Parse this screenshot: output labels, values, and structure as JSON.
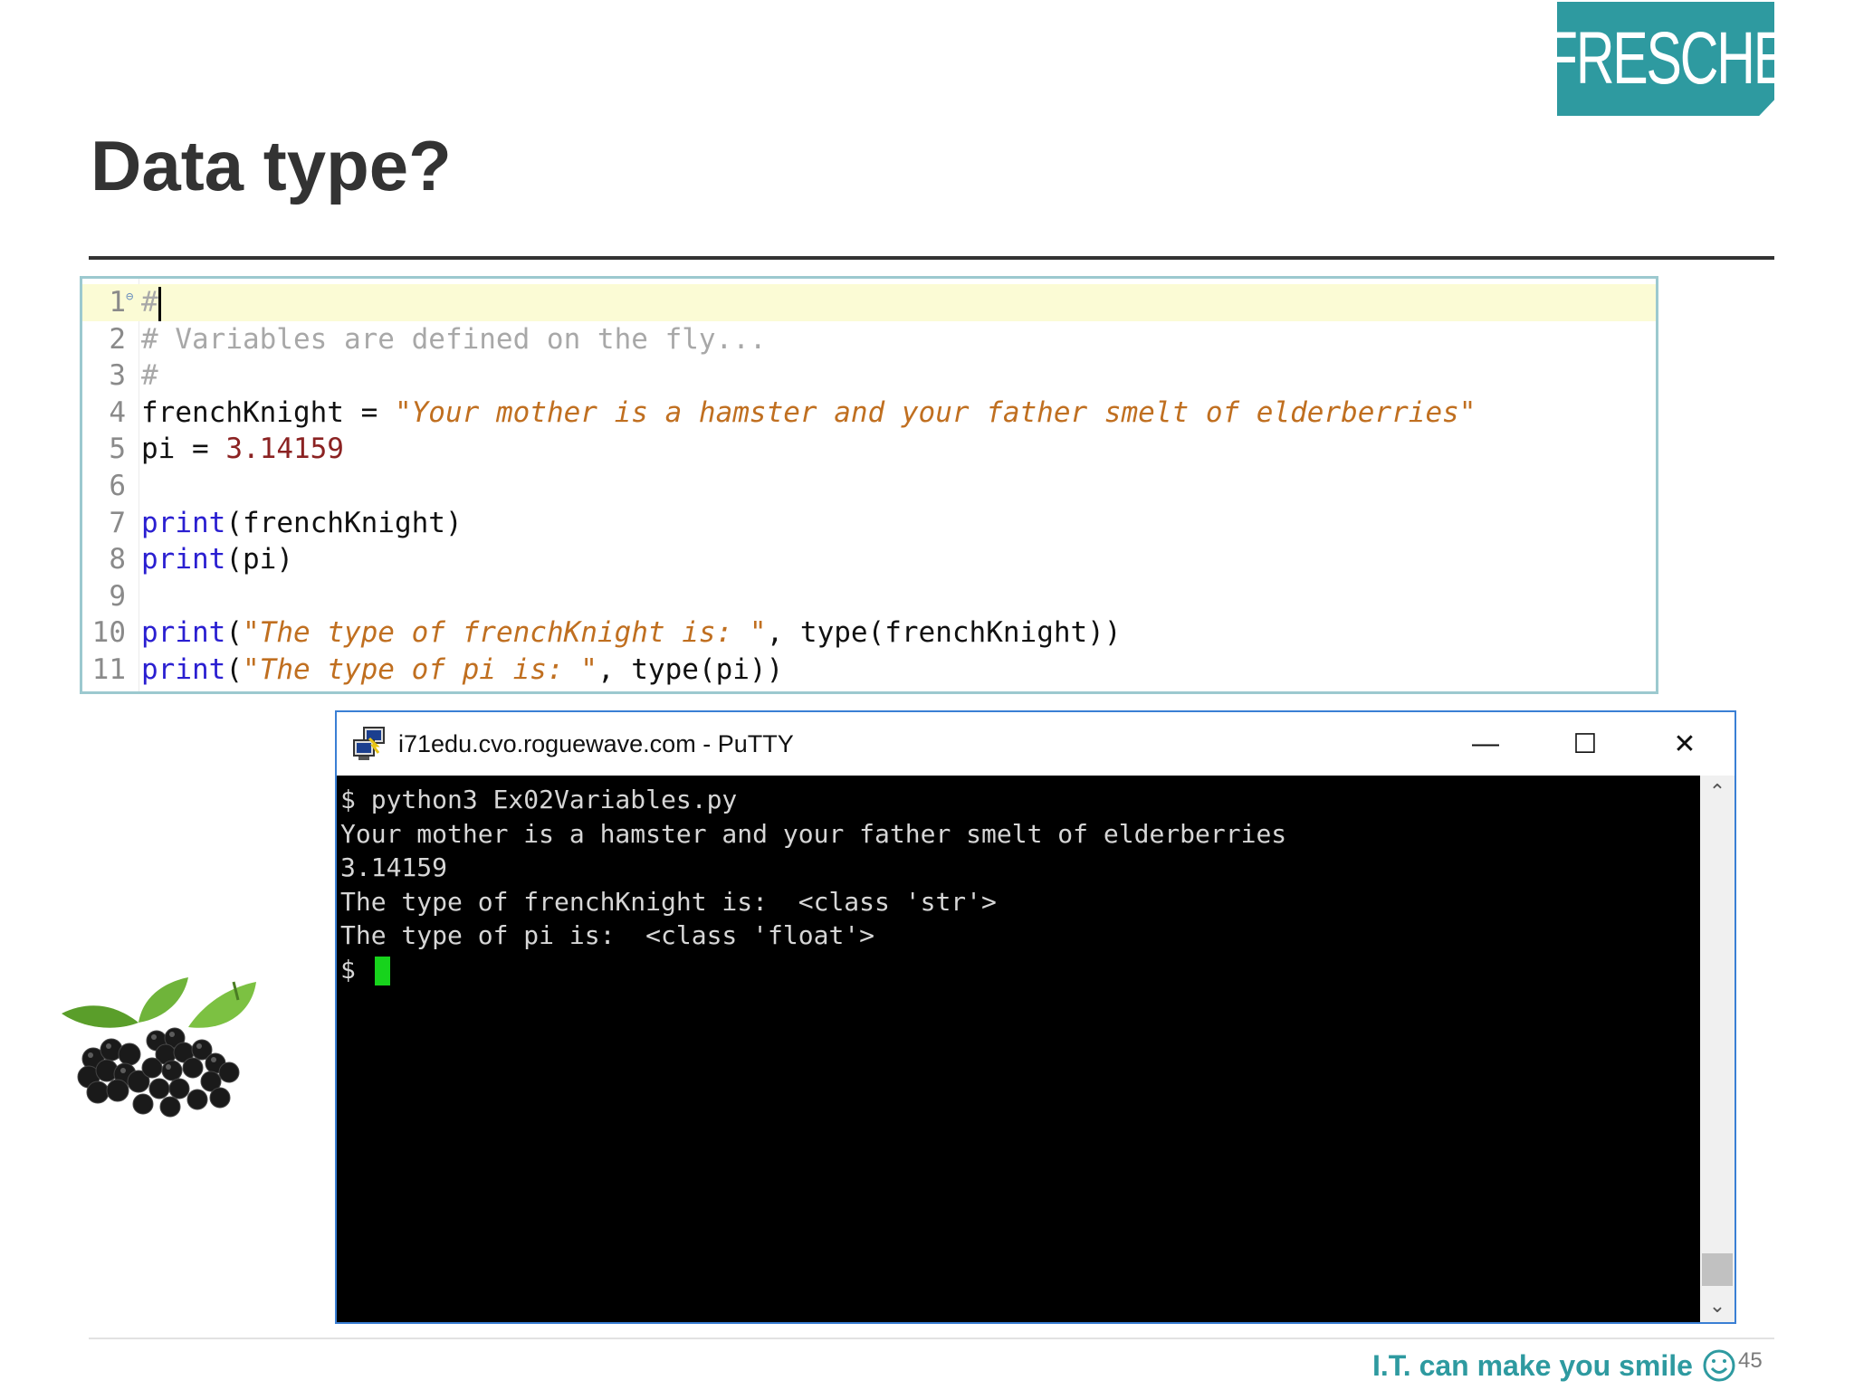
{
  "slide": {
    "logo_text": "FRESCHE",
    "title": "Data type?",
    "tagline": "I.T. can make you smile",
    "page_number": "45"
  },
  "editor": {
    "lines": [
      {
        "n": "1",
        "parts": [
          {
            "t": "#",
            "c": "cmt"
          }
        ]
      },
      {
        "n": "2",
        "parts": [
          {
            "t": "# Variables are defined on the fly...",
            "c": "cmt"
          }
        ]
      },
      {
        "n": "3",
        "parts": [
          {
            "t": "#",
            "c": "cmt"
          }
        ]
      },
      {
        "n": "4",
        "parts": [
          {
            "t": "frenchKnight = ",
            "c": "plain"
          },
          {
            "t": "\"Your mother is a hamster and your father smelt of elderberries\"",
            "c": "str"
          }
        ]
      },
      {
        "n": "5",
        "parts": [
          {
            "t": "pi = ",
            "c": "plain"
          },
          {
            "t": "3.14159",
            "c": "num"
          }
        ]
      },
      {
        "n": "6",
        "parts": []
      },
      {
        "n": "7",
        "parts": [
          {
            "t": "print",
            "c": "kw"
          },
          {
            "t": "(frenchKnight)",
            "c": "plain"
          }
        ]
      },
      {
        "n": "8",
        "parts": [
          {
            "t": "print",
            "c": "kw"
          },
          {
            "t": "(pi)",
            "c": "plain"
          }
        ]
      },
      {
        "n": "9",
        "parts": []
      },
      {
        "n": "10",
        "parts": [
          {
            "t": "print",
            "c": "kw"
          },
          {
            "t": "(",
            "c": "plain"
          },
          {
            "t": "\"The type of frenchKnight is: \"",
            "c": "str"
          },
          {
            "t": ", type(frenchKnight))",
            "c": "plain"
          }
        ]
      },
      {
        "n": "11",
        "parts": [
          {
            "t": "print",
            "c": "kw"
          },
          {
            "t": "(",
            "c": "plain"
          },
          {
            "t": "\"The type of pi is: \"",
            "c": "str"
          },
          {
            "t": ", type(pi))",
            "c": "plain"
          }
        ]
      }
    ]
  },
  "putty": {
    "window_title": "i71edu.cvo.roguewave.com - PuTTY",
    "minimize_glyph": "—",
    "maximize_glyph": "☐",
    "close_glyph": "✕",
    "terminal_lines": [
      "$ python3 Ex02Variables.py",
      "Your mother is a hamster and your father smelt of elderberries",
      "3.14159",
      "The type of frenchKnight is:  <class 'str'>",
      "The type of pi is:  <class 'float'>"
    ],
    "prompt": "$ "
  },
  "icons": {
    "putty_icon": "putty-icon",
    "smile_icon": "smile-icon",
    "berries_image": "blackberries-image"
  },
  "colors": {
    "brand_teal": "#2e9aa0",
    "terminal_cursor": "#17d31c",
    "keyword": "#2a1fd1",
    "string": "#c06f20",
    "number": "#8b2222",
    "comment": "#a8a8a8"
  }
}
